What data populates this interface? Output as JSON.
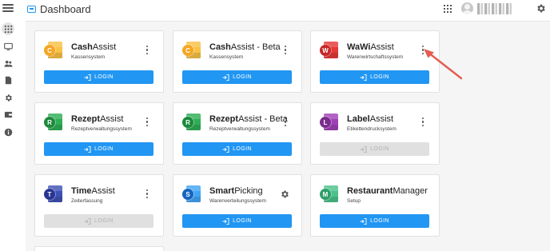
{
  "header": {
    "title": "Dashboard",
    "username": ""
  },
  "sidebar": {
    "items": [
      "apps-icon",
      "monitor-icon",
      "users-icon",
      "document-icon",
      "settings-icon",
      "wallet-icon",
      "info-icon"
    ]
  },
  "colors": {
    "accent": "#2196f3",
    "disabled": "#e0e0e0",
    "arrow": "#e35d4f"
  },
  "cards": [
    {
      "name_bold": "Cash",
      "name_rest": "Assist",
      "subtitle": "Kassensystem",
      "logo_letter": "C",
      "logo_color": "#f5a623",
      "logo_back_color": "#f8c147",
      "action": "kebab",
      "login_label": "LOGIN",
      "login_enabled": true
    },
    {
      "name_bold": "Cash",
      "name_rest": "Assist - Beta",
      "subtitle": "Kassensystem",
      "logo_letter": "C",
      "logo_color": "#f5a623",
      "logo_back_color": "#f8c147",
      "action": "kebab",
      "login_label": "LOGIN",
      "login_enabled": true
    },
    {
      "name_bold": "WaWi",
      "name_rest": "Assist",
      "subtitle": "Warenwirtschaftssystem",
      "logo_letter": "W",
      "logo_color": "#c62828",
      "logo_back_color": "#e53935",
      "action": "kebab",
      "login_label": "LOGIN",
      "login_enabled": true
    },
    {
      "name_bold": "Rezept",
      "name_rest": "Assist",
      "subtitle": "Rezeptverwaltungssystem",
      "logo_letter": "R",
      "logo_color": "#1b8a3c",
      "logo_back_color": "#2fae55",
      "action": "kebab",
      "login_label": "LOGIN",
      "login_enabled": true
    },
    {
      "name_bold": "Rezept",
      "name_rest": "Assist - Beta",
      "subtitle": "Rezeptverwaltungssystem",
      "logo_letter": "R",
      "logo_color": "#1b8a3c",
      "logo_back_color": "#2fae55",
      "action": "kebab",
      "login_label": "LOGIN",
      "login_enabled": true
    },
    {
      "name_bold": "Label",
      "name_rest": "Assist",
      "subtitle": "Etikettendrucksystem",
      "logo_letter": "L",
      "logo_color": "#7b2d8e",
      "logo_back_color": "#a040b8",
      "action": "kebab",
      "login_label": "LOGIN",
      "login_enabled": false
    },
    {
      "name_bold": "Time",
      "name_rest": "Assist",
      "subtitle": "Zeiterfassung",
      "logo_letter": "T",
      "logo_color": "#283593",
      "logo_back_color": "#3f51b5",
      "action": "kebab",
      "login_label": "LOGIN",
      "login_enabled": false
    },
    {
      "name_bold": "Smart",
      "name_rest": "Picking",
      "subtitle": "Warenverteilungssystem",
      "logo_letter": "S",
      "logo_color": "#1565c0",
      "logo_back_color": "#42a5f5",
      "action": "gear",
      "login_label": "LOGIN",
      "login_enabled": true
    },
    {
      "name_bold": "Restaurant",
      "name_rest": "Manager",
      "subtitle": "Setup",
      "logo_letter": "M",
      "logo_color": "#2e9e6a",
      "logo_back_color": "#4cc28a",
      "action": "none",
      "login_label": "LOGIN",
      "login_enabled": true
    }
  ]
}
